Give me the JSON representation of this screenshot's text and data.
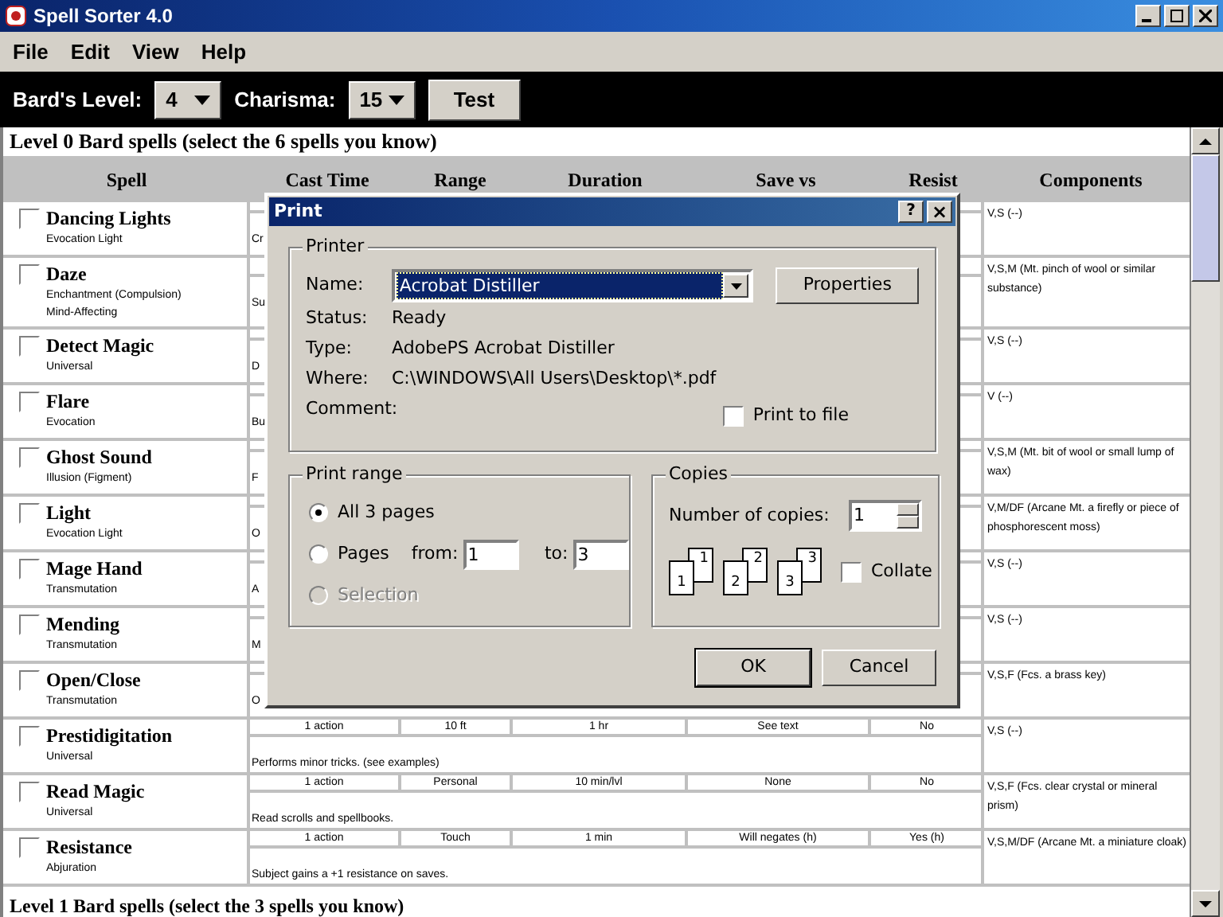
{
  "window": {
    "title": "Spell Sorter 4.0"
  },
  "menu": [
    "File",
    "Edit",
    "View",
    "Help"
  ],
  "toolbar": {
    "level_label": "Bard's Level:",
    "level_value": "4",
    "charisma_label": "Charisma:",
    "charisma_value": "15",
    "test_button": "Test"
  },
  "sections": [
    {
      "title": "Level 0 Bard spells (select the 6 spells you know)",
      "columns": [
        "Spell",
        "Cast Time",
        "Range",
        "Duration",
        "Save vs",
        "Resist",
        "Components"
      ],
      "spells": [
        {
          "name": "Dancing Lights",
          "school": [
            "Evocation Light"
          ],
          "checked": false,
          "description": "Cr",
          "components": "V,S (--)"
        },
        {
          "name": "Daze",
          "school": [
            "Enchantment (Compulsion)",
            "Mind-Affecting"
          ],
          "checked": false,
          "description": "Su",
          "components": "V,S,M (Mt. pinch of wool or similar substance)"
        },
        {
          "name": "Detect Magic",
          "school": [
            "Universal"
          ],
          "checked": false,
          "description": "D",
          "components": "V,S (--)"
        },
        {
          "name": "Flare",
          "school": [
            "Evocation"
          ],
          "checked": false,
          "description": "Bu",
          "components": "V (--)"
        },
        {
          "name": "Ghost Sound",
          "school": [
            "Illusion (Figment)"
          ],
          "checked": false,
          "description": "F",
          "components": "V,S,M (Mt. bit of wool or small lump of wax)"
        },
        {
          "name": "Light",
          "school": [
            "Evocation Light"
          ],
          "checked": false,
          "description": "O",
          "components": "V,M/DF (Arcane Mt. a firefly or piece of phosphorescent moss)"
        },
        {
          "name": "Mage Hand",
          "school": [
            "Transmutation"
          ],
          "checked": false,
          "description": "A",
          "components": "V,S (--)"
        },
        {
          "name": "Mending",
          "school": [
            "Transmutation"
          ],
          "checked": false,
          "description": "M",
          "components": "V,S (--)"
        },
        {
          "name": "Open/Close",
          "school": [
            "Transmutation"
          ],
          "checked": false,
          "description": "O",
          "components": "V,S,F (Fcs. a brass key)"
        },
        {
          "name": "Prestidigitation",
          "school": [
            "Universal"
          ],
          "checked": false,
          "cells": [
            "1 action",
            "10 ft",
            "1 hr",
            "See text",
            "No"
          ],
          "description": "Performs minor tricks. (see examples)",
          "components": "V,S (--)"
        },
        {
          "name": "Read Magic",
          "school": [
            "Universal"
          ],
          "checked": false,
          "cells": [
            "1 action",
            "Personal",
            "10 min/lvl",
            "None",
            "No"
          ],
          "description": "Read scrolls and spellbooks.",
          "components": "V,S,F (Fcs. clear crystal or mineral prism)"
        },
        {
          "name": "Resistance",
          "school": [
            "Abjuration"
          ],
          "checked": false,
          "cells": [
            "1 action",
            "Touch",
            "1 min",
            "Will negates (h)",
            "Yes (h)"
          ],
          "description": "Subject gains a +1 resistance on saves.",
          "components": "V,S,M/DF (Arcane Mt. a miniature cloak)"
        }
      ]
    },
    {
      "title": "Level 1 Bard spells (select the 3 spells you know)"
    }
  ],
  "print_dialog": {
    "title": "Print",
    "help": "?",
    "close": "×",
    "printer": {
      "legend": "Printer",
      "name_label": "Name:",
      "name_value": "Acrobat Distiller",
      "properties": "Properties",
      "info": [
        {
          "label": "Status:",
          "value": "Ready"
        },
        {
          "label": "Type:",
          "value": "AdobePS Acrobat Distiller"
        },
        {
          "label": "Where:",
          "value": "C:\\WINDOWS\\All Users\\Desktop\\*.pdf"
        },
        {
          "label": "Comment:"
        }
      ],
      "print_to_file": {
        "label": "Print to file",
        "checked": false
      }
    },
    "range": {
      "legend": "Print range",
      "options": [
        {
          "label": "All 3 pages",
          "selected": true,
          "disabled": false
        },
        {
          "label": "Pages",
          "selected": false,
          "disabled": false
        },
        {
          "label": "Selection",
          "selected": false,
          "disabled": true
        }
      ],
      "from_label": "from:",
      "from_value": "1",
      "to_label": "to:",
      "to_value": "3"
    },
    "copies": {
      "legend": "Copies",
      "count_label": "Number of copies:",
      "count_value": "1",
      "pages": [
        {
          "back": "1",
          "front": "1"
        },
        {
          "back": "2",
          "front": "2"
        },
        {
          "back": "3",
          "front": "3"
        }
      ],
      "collate": {
        "label": "Collate",
        "checked": false
      }
    },
    "buttons": [
      "OK",
      "Cancel"
    ]
  }
}
